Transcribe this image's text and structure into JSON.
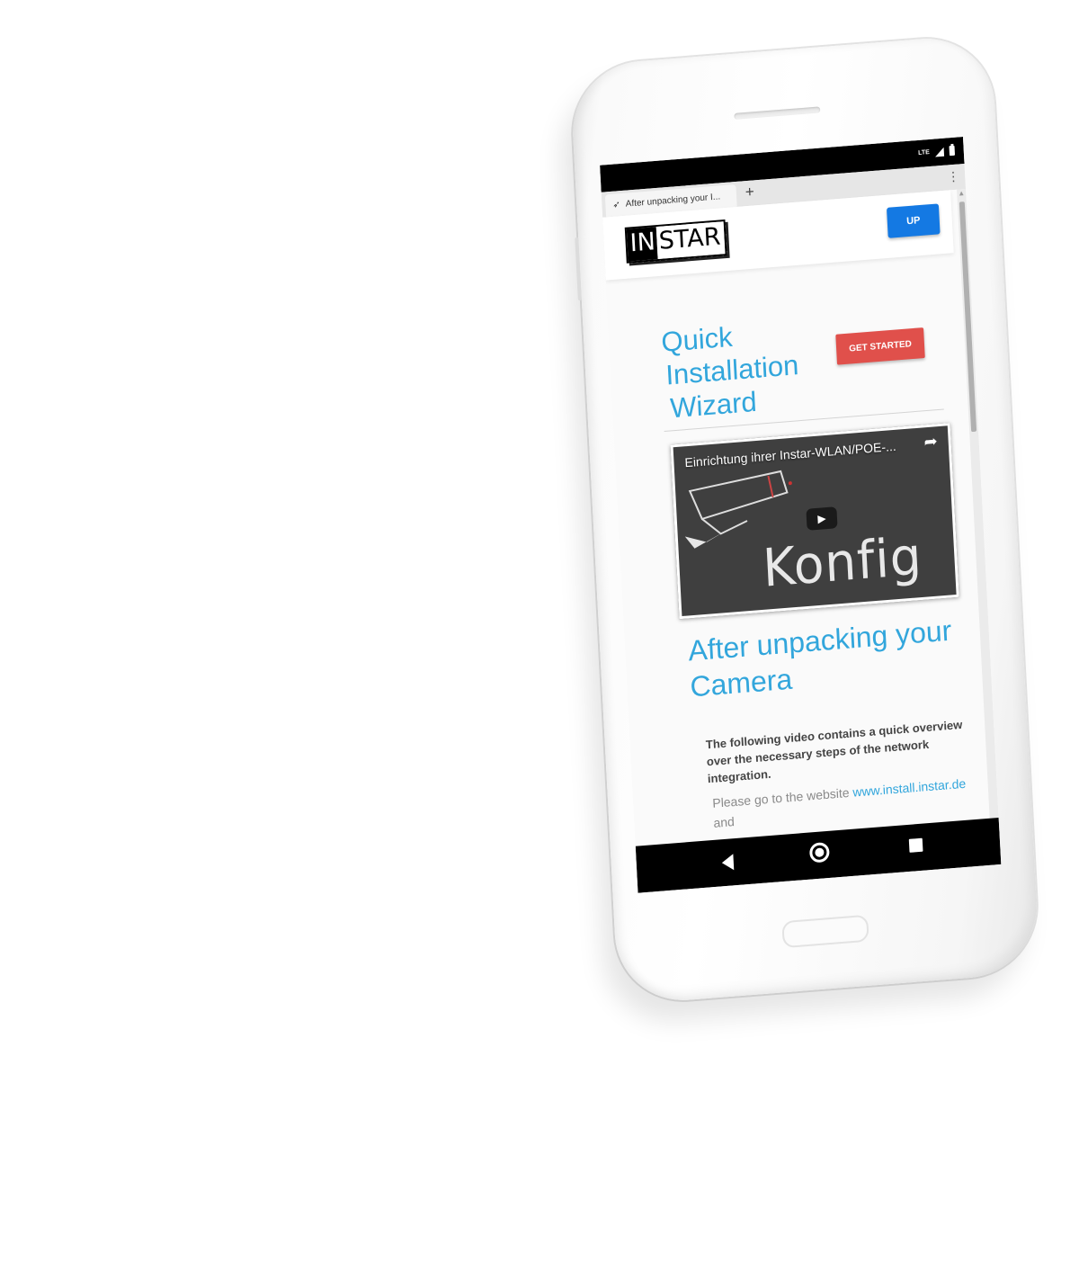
{
  "status_bar": {
    "network": "LTE"
  },
  "browser": {
    "tab_title": "After unpacking your I...",
    "new_tab_label": "+",
    "menu_label": "⋮"
  },
  "header": {
    "logo_in": "IN",
    "logo_star": "STAR",
    "up_label": "UP",
    "up_color": "#1479e3"
  },
  "wizard": {
    "title_lines": [
      "Quick",
      "Installation",
      "Wizard"
    ],
    "button_label": "GET STARTED",
    "button_color": "#e0504b"
  },
  "video": {
    "title": "Einrichtung ihrer Instar-WLAN/POE-...",
    "brand_text": "Konfig"
  },
  "section": {
    "title": "After unpacking your Camera",
    "intro": "The following video contains a quick overview over the necessary steps of the network integration.",
    "body_before_link": "Please go to the website ",
    "link_text": "www.install.instar.de",
    "body_after_link": " and"
  },
  "colors": {
    "accent": "#32a6dc"
  },
  "icons": [
    "signal-icon",
    "battery-icon",
    "share-icon",
    "play-icon",
    "back-icon",
    "home-icon",
    "recents-icon"
  ]
}
